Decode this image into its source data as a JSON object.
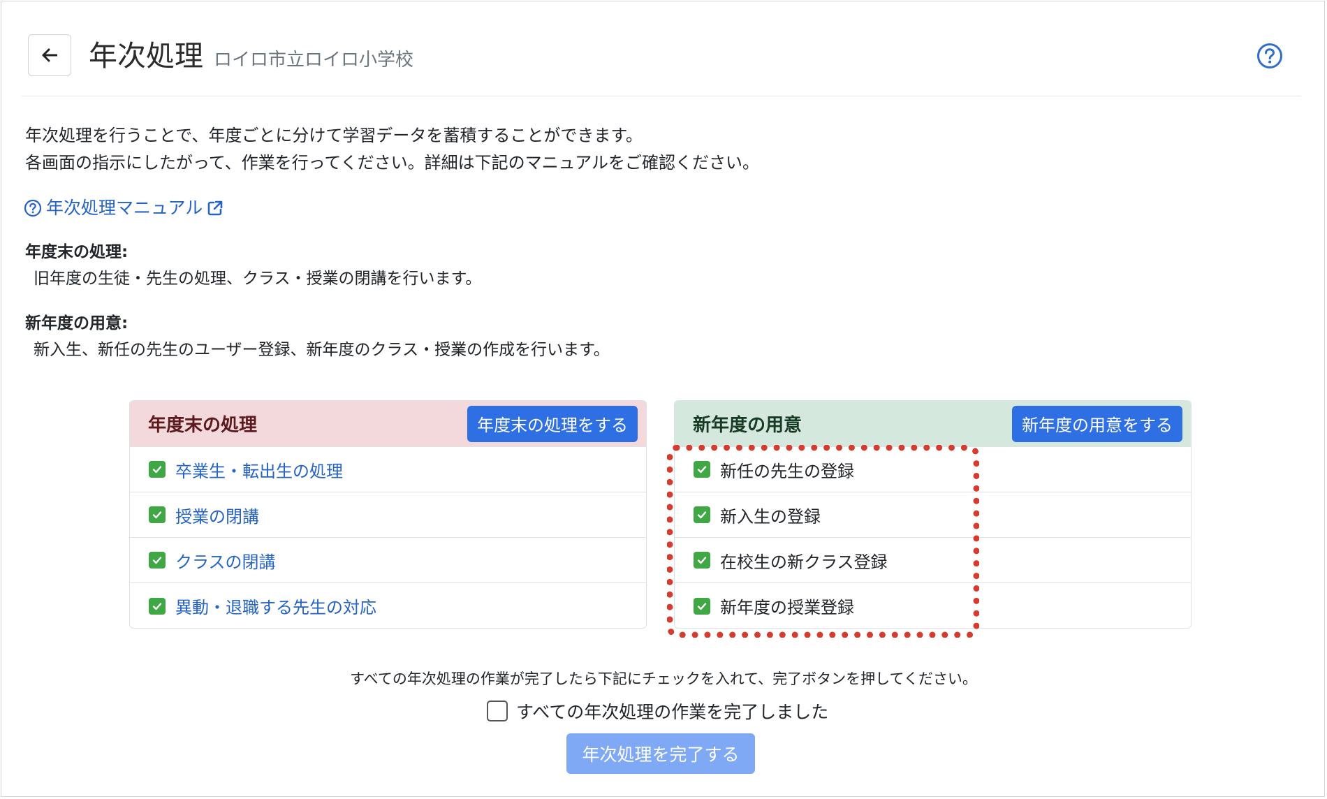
{
  "header": {
    "title": "年次処理",
    "school": "ロイロ市立ロイロ小学校",
    "back_icon": "arrow-left-icon",
    "help_icon": "question-circle-icon"
  },
  "intro": {
    "line1": "年次処理を行うことで、年度ごとに分けて学習データを蓄積することができます。",
    "line2": "各画面の指示にしたがって、作業を行ってください。詳細は下記のマニュアルをご確認ください。"
  },
  "manual_link": {
    "label": "年次処理マニュアル"
  },
  "sections": {
    "end_heading": "年度末の処理:",
    "end_desc": "旧年度の生徒・先生の処理、クラス・授業の閉講を行います。",
    "new_heading": "新年度の用意:",
    "new_desc": "新入生、新任の先生のユーザー登録、新年度のクラス・授業の作成を行います。"
  },
  "end_card": {
    "title": "年度末の処理",
    "button": "年度末の処理をする",
    "items": [
      {
        "label": "卒業生・転出生の処理",
        "checked": true
      },
      {
        "label": "授業の閉講",
        "checked": true
      },
      {
        "label": "クラスの閉講",
        "checked": true
      },
      {
        "label": "異動・退職する先生の対応",
        "checked": true
      }
    ]
  },
  "new_card": {
    "title": "新年度の用意",
    "button": "新年度の用意をする",
    "items": [
      {
        "label": "新任の先生の登録",
        "checked": true
      },
      {
        "label": "新入生の登録",
        "checked": true
      },
      {
        "label": "在校生の新クラス登録",
        "checked": true
      },
      {
        "label": "新年度の授業登録",
        "checked": true
      }
    ]
  },
  "footer": {
    "note": "すべての年次処理の作業が完了したら下記にチェックを入れて、完了ボタンを押してください。",
    "checkbox_label": "すべての年次処理の作業を完了しました",
    "checkbox_checked": false,
    "complete_button": "年次処理を完了する"
  },
  "colors": {
    "accent": "#2f6fe4",
    "link": "#2563c4",
    "end_header_bg": "#f3d9db",
    "new_header_bg": "#d5e8dd",
    "check_green": "#3fa845",
    "highlight_red": "#d63b2f",
    "disabled_button": "#7fa8f5"
  }
}
